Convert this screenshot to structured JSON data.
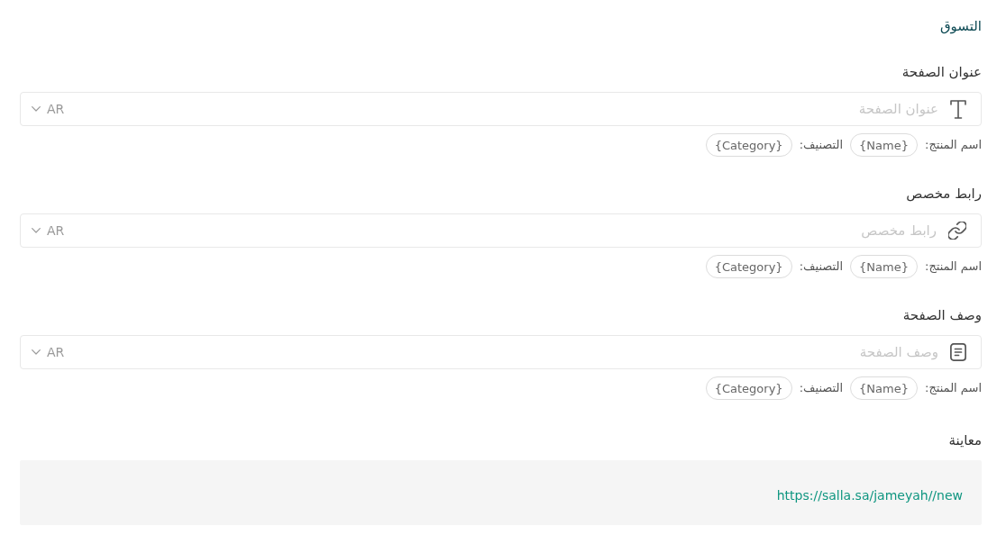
{
  "section_title": "التسوق",
  "fields": [
    {
      "label": "عنوان الصفحة",
      "kind": "title",
      "placeholder": "عنوان الصفحة",
      "language": "AR",
      "variables": [
        {
          "label": "اسم المنتج:",
          "token": "{Name}"
        },
        {
          "label": "التصنيف:",
          "token": "{Category}"
        }
      ]
    },
    {
      "label": "رابط مخصص",
      "kind": "link",
      "placeholder": "رابط مخصص",
      "language": "AR",
      "variables": [
        {
          "label": "اسم المنتج:",
          "token": "{Name}"
        },
        {
          "label": "التصنيف:",
          "token": "{Category}"
        }
      ]
    },
    {
      "label": "وصف الصفحة",
      "kind": "description",
      "placeholder": "وصف الصفحة",
      "language": "AR",
      "variables": [
        {
          "label": "اسم المنتج:",
          "token": "{Name}"
        },
        {
          "label": "التصنيف:",
          "token": "{Category}"
        }
      ]
    }
  ],
  "preview": {
    "label": "معاينة",
    "url": "https://salla.sa/jameyah//new"
  }
}
